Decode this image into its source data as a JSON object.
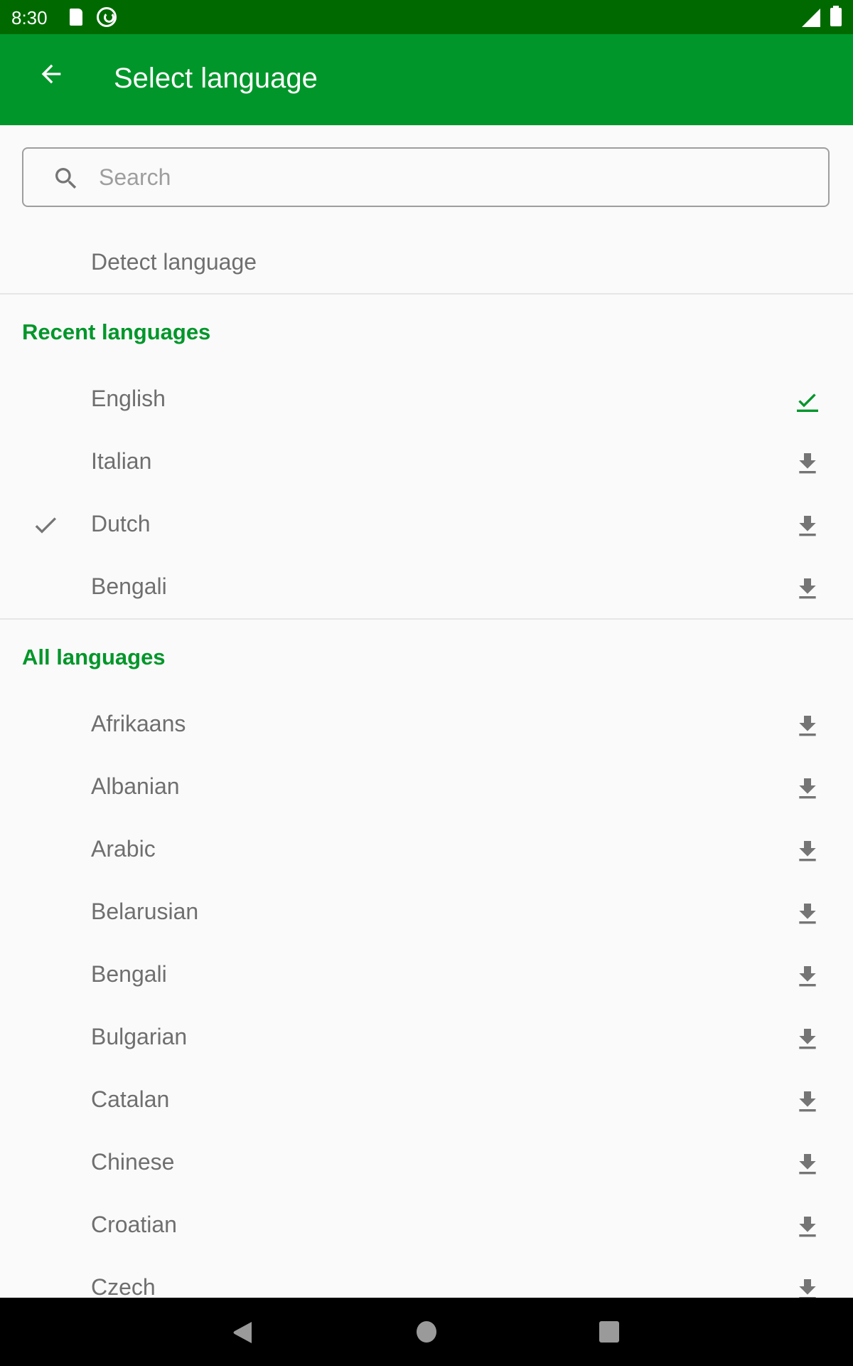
{
  "status_bar": {
    "time": "8:30",
    "icons": [
      "sd-card-icon",
      "q-icon",
      "signal-no-data-icon",
      "battery-icon"
    ]
  },
  "app_bar": {
    "title": "Select language",
    "back_icon": "arrow-left-icon",
    "background_color": "#00962a"
  },
  "search": {
    "placeholder": "Search",
    "value": "",
    "icon": "search-icon"
  },
  "detect_language": {
    "label": "Detect language"
  },
  "recent_section": {
    "title": "Recent languages",
    "items": [
      {
        "label": "English",
        "selected": false,
        "action_icon": "downloaded-check-icon",
        "downloaded": true
      },
      {
        "label": "Italian",
        "selected": false,
        "action_icon": "download-icon",
        "downloaded": false
      },
      {
        "label": "Dutch",
        "selected": true,
        "action_icon": "download-icon",
        "downloaded": false
      },
      {
        "label": "Bengali",
        "selected": false,
        "action_icon": "download-icon",
        "downloaded": false
      }
    ]
  },
  "all_section": {
    "title": "All languages",
    "items": [
      {
        "label": "Afrikaans",
        "action_icon": "download-icon"
      },
      {
        "label": "Albanian",
        "action_icon": "download-icon"
      },
      {
        "label": "Arabic",
        "action_icon": "download-icon"
      },
      {
        "label": "Belarusian",
        "action_icon": "download-icon"
      },
      {
        "label": "Bengali",
        "action_icon": "download-icon"
      },
      {
        "label": "Bulgarian",
        "action_icon": "download-icon"
      },
      {
        "label": "Catalan",
        "action_icon": "download-icon"
      },
      {
        "label": "Chinese",
        "action_icon": "download-icon"
      },
      {
        "label": "Croatian",
        "action_icon": "download-icon"
      },
      {
        "label": "Czech",
        "action_icon": "download-icon"
      }
    ]
  },
  "colors": {
    "status_bar": "#006a00",
    "accent": "#00962a",
    "text_secondary": "#6f6f6f",
    "icon_gray": "#757575"
  },
  "nav_bar": {
    "buttons": [
      "back",
      "home",
      "recents"
    ]
  }
}
